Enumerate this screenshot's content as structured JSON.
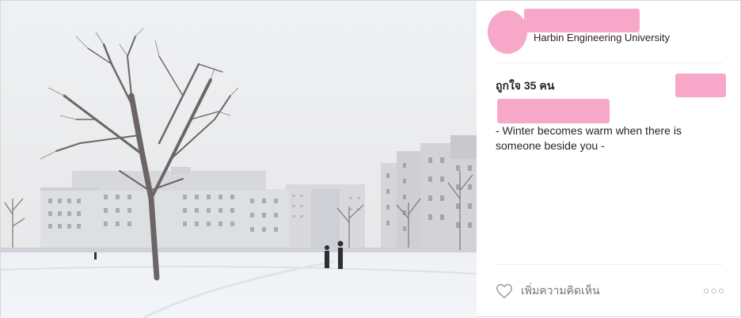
{
  "post": {
    "location": "Harbin Engineering University",
    "likes": "ถูกใจ 35 คน",
    "caption": "- Winter becomes warm when there is someone beside you -"
  },
  "actions": {
    "comment_placeholder": "เพิ่มความคิดเห็น",
    "more": "○○○"
  },
  "icons": {
    "like": "heart-outline-icon",
    "more": "more-options-icon"
  },
  "colors": {
    "redaction": "#f7a8c8",
    "text": "#262626",
    "muted": "#999999"
  }
}
